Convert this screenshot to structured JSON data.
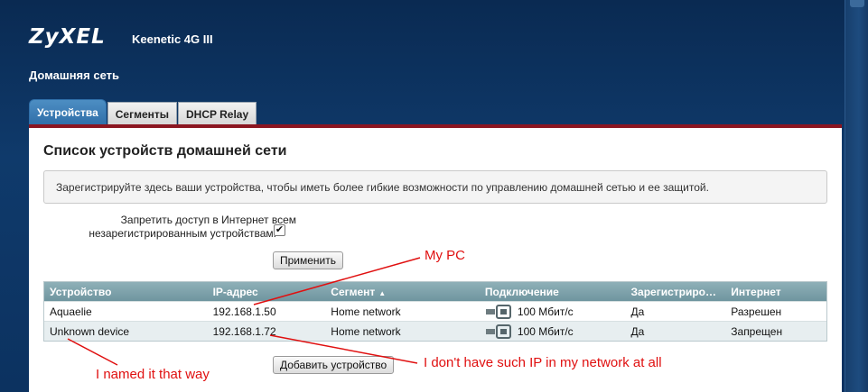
{
  "header": {
    "logo": "ZyXEL",
    "model": "Keenetic 4G III",
    "section_title": "Домашняя сеть"
  },
  "tabs": [
    {
      "label": "Устройства",
      "active": true
    },
    {
      "label": "Сегменты",
      "active": false
    },
    {
      "label": "DHCP Relay",
      "active": false
    }
  ],
  "panel": {
    "title": "Список устройств домашней сети",
    "info": "Зарегистрируйте здесь ваши устройства, чтобы иметь более гибкие возможности по управлению домашней сетью и ее защитой.",
    "block_label_line1": "Запретить доступ в Интернет всем",
    "block_label_line2": "незарегистрированным устройствам:",
    "block_checked": true,
    "checkmark": "✔",
    "apply_label": "Применить",
    "add_device_label": "Добавить устройство"
  },
  "table": {
    "columns": [
      "Устройство",
      "IP-адрес",
      "Сегмент",
      "Подключение",
      "Зарегистриро…",
      "Интернет"
    ],
    "sort_indicator": "▲",
    "rows": [
      {
        "device": "Aquaelie",
        "ip": "192.168.1.50",
        "segment": "Home network",
        "connection": "100 Мбит/с",
        "registered": "Да",
        "internet": "Разрешен"
      },
      {
        "device": "Unknown device",
        "ip": "192.168.1.72",
        "segment": "Home network",
        "connection": "100 Мбит/с",
        "registered": "Да",
        "internet": "Запрещен"
      }
    ]
  },
  "annotations": {
    "my_pc": "My PC",
    "named": "I named it that way",
    "no_ip": "I don't have such IP in my network at all"
  },
  "colors": {
    "accent_red": "#8b1520",
    "annotation": "#e01010",
    "table_header": "#7fa2ab"
  }
}
